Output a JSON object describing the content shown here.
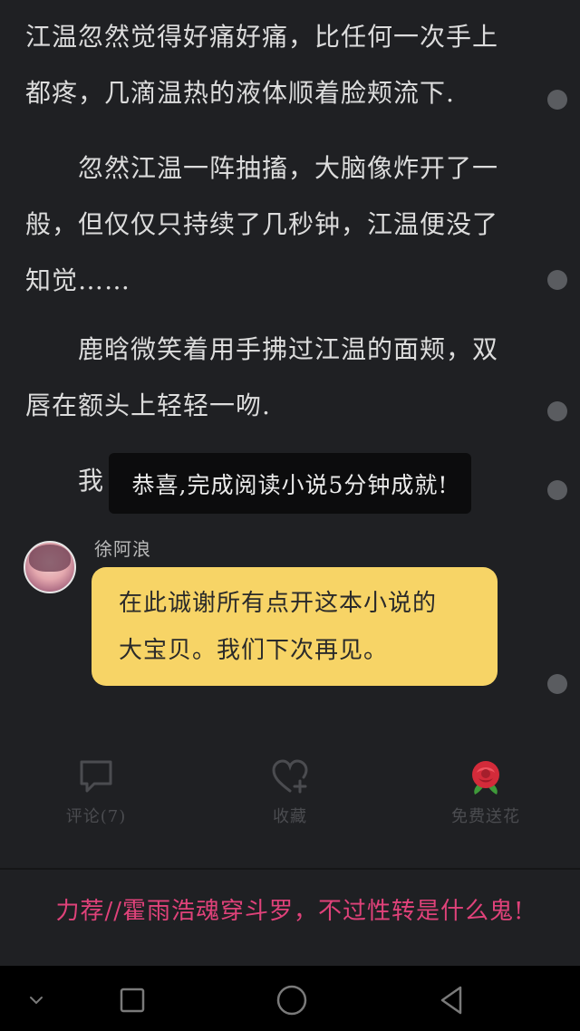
{
  "paragraphs": [
    {
      "lines": [
        "江温忽然觉得好痛好痛，比任何一次手上",
        "都疼，几滴温热的液体顺着脸颊流下."
      ]
    },
    {
      "lines": [
        "　　忽然江温一阵抽搐，大脑像炸开了一",
        "般，但仅仅只持续了几秒钟，江温便没了",
        "知觉……"
      ]
    },
    {
      "lines": [
        "　　鹿晗微笑着用手拂过江温的面颊，双",
        "唇在额头上轻轻一吻."
      ]
    },
    {
      "lines": [
        "　　我"
      ]
    }
  ],
  "toast": "恭喜,完成阅读小说5分钟成就!",
  "author_note": {
    "name": "徐阿浪",
    "message_lines": [
      "在此诚谢所有点开这本小说的",
      "大宝贝。我们下次再见。"
    ]
  },
  "actions": {
    "comment_label": "评论(7)",
    "favorite_label": "收藏",
    "flower_label": "免费送花"
  },
  "next_chapter": "力荐//霍雨浩魂穿斗罗，不过性转是什么鬼!",
  "colors": {
    "background": "#1f2023",
    "bubble": "#f7d466",
    "link": "#e0427a"
  },
  "icons": [
    "comment-icon",
    "heart-add-icon",
    "rose-icon",
    "chevron-down-icon",
    "square-icon",
    "circle-icon",
    "triangle-back-icon"
  ]
}
